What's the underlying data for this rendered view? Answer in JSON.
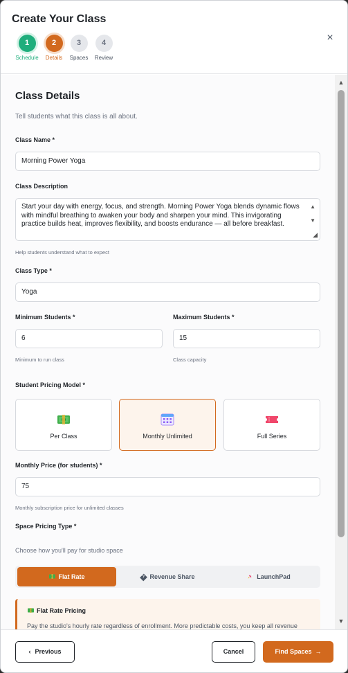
{
  "header": {
    "title": "Create Your Class",
    "close": "×",
    "steps": [
      {
        "num": "1",
        "label": "Schedule"
      },
      {
        "num": "2",
        "label": "Details"
      },
      {
        "num": "3",
        "label": "Spaces"
      },
      {
        "num": "4",
        "label": "Review"
      }
    ]
  },
  "form": {
    "title": "Class Details",
    "subtitle": "Tell students what this class is all about.",
    "class_name": {
      "label": "Class Name *",
      "value": "Morning Power Yoga"
    },
    "description": {
      "label": "Class Description",
      "value": "Start your day with energy, focus, and strength. Morning Power Yoga blends dynamic flows with mindful breathing to awaken your body and sharpen your mind. This invigorating practice builds heat, improves flexibility, and boosts endurance — all before breakfast.",
      "help": "Help students understand what to expect"
    },
    "class_type": {
      "label": "Class Type *",
      "value": "Yoga"
    },
    "min_students": {
      "label": "Minimum Students *",
      "value": "6",
      "help": "Minimum to run class"
    },
    "max_students": {
      "label": "Maximum Students *",
      "value": "15",
      "help": "Class capacity"
    },
    "pricing_model": {
      "label": "Student Pricing Model *",
      "options": [
        {
          "label": "Per Class",
          "icon": "money-icon"
        },
        {
          "label": "Monthly Unlimited",
          "icon": "calendar-icon"
        },
        {
          "label": "Full Series",
          "icon": "ticket-icon"
        }
      ],
      "selected": "Monthly Unlimited"
    },
    "monthly_price": {
      "label": "Monthly Price (for students) *",
      "value": "75",
      "help": "Monthly subscription price for unlimited classes"
    },
    "space_pricing": {
      "label": "Space Pricing Type *",
      "subtitle": "Choose how you'll pay for studio space",
      "tabs": [
        {
          "label": "Flat Rate",
          "icon": "money-icon"
        },
        {
          "label": "Revenue Share",
          "icon": "?"
        },
        {
          "label": "LaunchPad",
          "icon": "rocket-icon"
        }
      ],
      "selected": "Flat Rate",
      "info_title": "Flat Rate Pricing",
      "info_text": "Pay the studio's hourly rate regardless of enrollment. More predictable costs, you keep all revenue"
    }
  },
  "footer": {
    "previous": "Previous",
    "cancel": "Cancel",
    "find_spaces": "Find Spaces",
    "prev_glyph": "‹",
    "next_glyph": "→"
  },
  "colors": {
    "accent": "#d2691e",
    "success": "#1fae7c"
  }
}
